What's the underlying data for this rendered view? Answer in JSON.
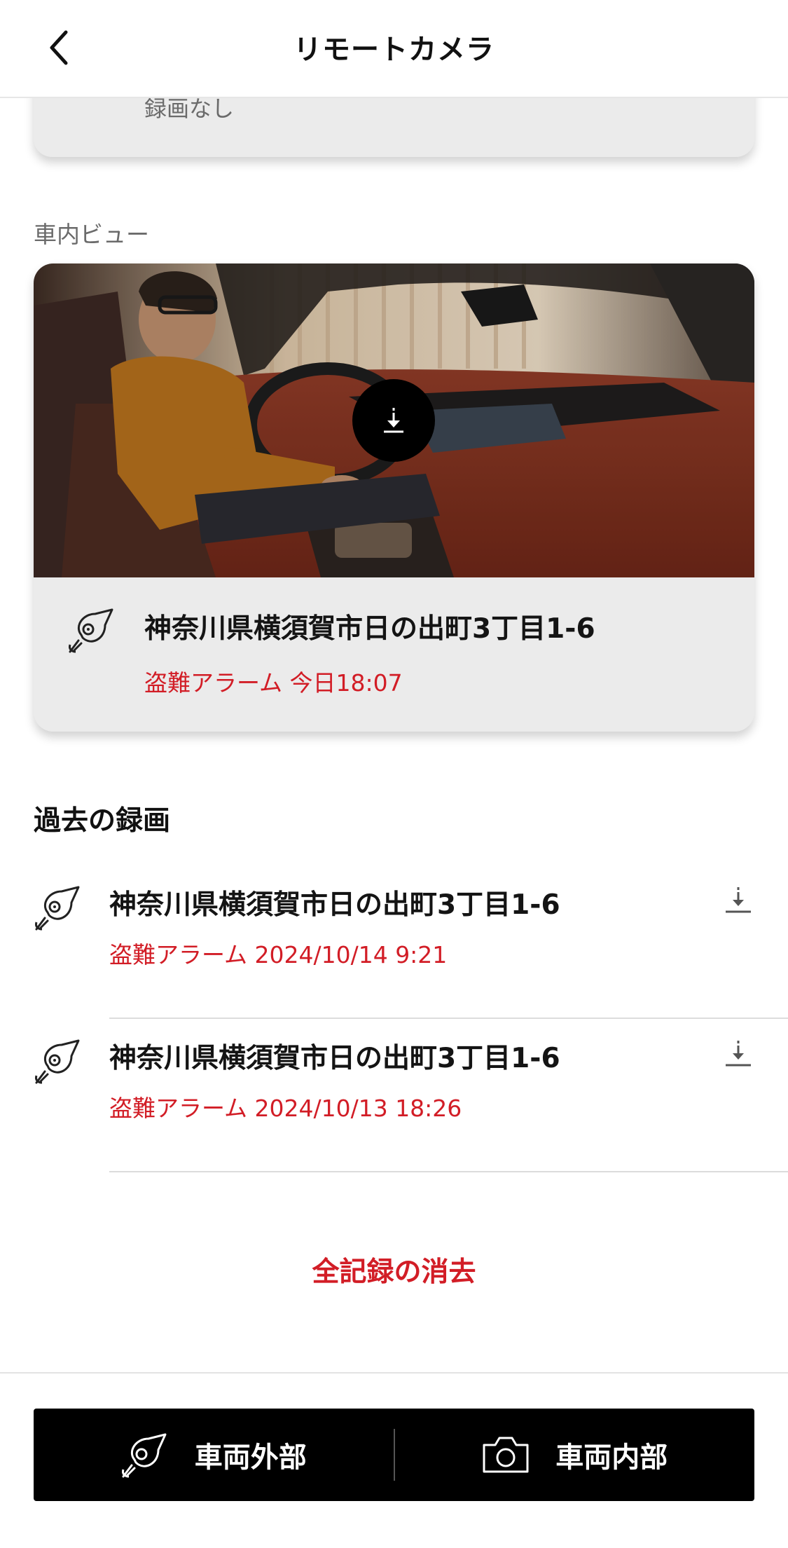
{
  "header": {
    "title": "リモートカメラ",
    "back_icon": "chevron-left-icon"
  },
  "top_card": {
    "text": "録画なし"
  },
  "interior_view": {
    "section_label": "車内ビュー",
    "photo_icon": "download-icon",
    "address": "神奈川県横須賀市日の出町3丁目1-6",
    "status": "盗難アラーム 今日18:07",
    "location_icon": "car-satellite-icon"
  },
  "past_recordings": {
    "title": "過去の録画",
    "items": [
      {
        "address": "神奈川県横須賀市日の出町3丁目1-6",
        "status": "盗難アラーム 2024/10/14 9:21",
        "icon": "car-satellite-icon",
        "action_icon": "download-icon"
      },
      {
        "address": "神奈川県横須賀市日の出町3丁目1-6",
        "status": "盗難アラーム 2024/10/13 18:26",
        "icon": "car-satellite-icon",
        "action_icon": "download-icon"
      }
    ]
  },
  "clear_all_label": "全記録の消去",
  "bottom_bar": {
    "exterior_label": "車両外部",
    "exterior_icon": "car-satellite-icon",
    "interior_label": "車両内部",
    "interior_icon": "camera-icon"
  },
  "colors": {
    "accent_red": "#d21d26",
    "card_bg": "#ebebeb",
    "bar_bg": "#000000"
  }
}
